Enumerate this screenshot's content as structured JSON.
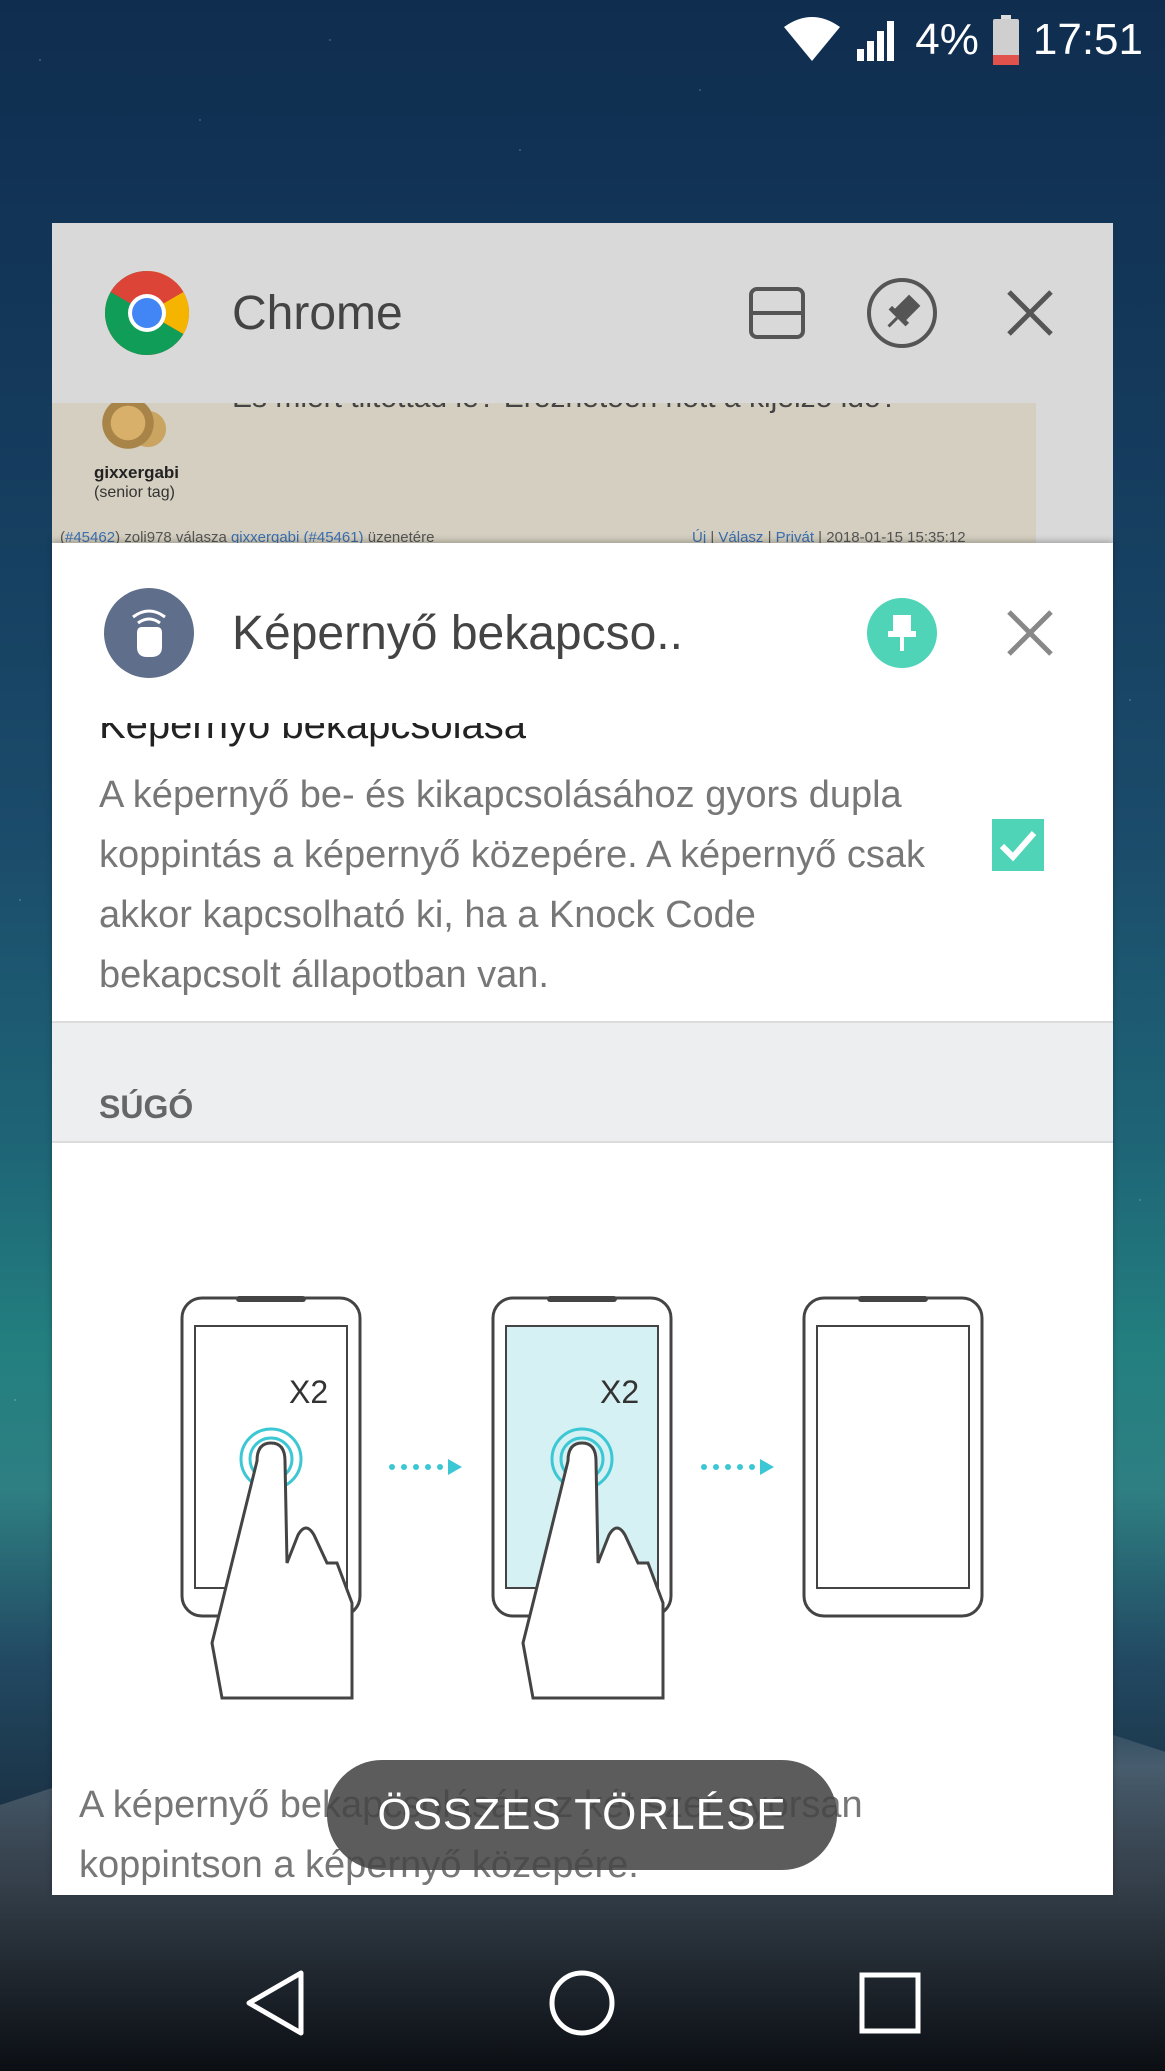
{
  "status_bar": {
    "battery_percent": "4%",
    "time": "17:51",
    "icons": [
      "wifi-icon",
      "signal-icon",
      "battery-icon"
    ]
  },
  "chrome_card": {
    "app_name": "Chrome",
    "icons": [
      "chrome-logo-icon",
      "split-screen-icon",
      "pin-icon",
      "close-icon"
    ],
    "preview": {
      "cropped_line": "Es miert tiltottad le? Erezhetoen hott a kijelzo ido?",
      "username": "gixxergabi",
      "rank": "(senior tag)",
      "meta_left_prefix": "(",
      "meta_left_link1": "#45462",
      "meta_left_mid": ") zoli978 válasza ",
      "meta_left_link2": "gixxergabi",
      "meta_left_link3": " (#45461)",
      "meta_left_suffix": " üzenetére",
      "meta_right_link1": "Új",
      "meta_right_sep1": " | ",
      "meta_right_link2": "Válasz",
      "meta_right_sep2": " | ",
      "meta_right_link3": "Privát",
      "meta_right_date": " | 2018-01-15 15:35:12"
    }
  },
  "settings_card": {
    "app_name": "Képernyő bekapcso..",
    "icons": [
      "knock-hand-icon",
      "pin-icon",
      "close-icon"
    ],
    "setting_title": "Képernyő bekapcsolása",
    "setting_description": "A képernyő be- és kikapcsolásához gyors dupla koppintás a képernyő közepére. A képernyő csak akkor kapcsolható ki, ha a Knock Code bekapcsolt állapotban van.",
    "checkbox_checked": true,
    "help_label": "SÚGÓ",
    "illustration": {
      "step1_label": "X2",
      "step2_label": "X2"
    },
    "help_text": "A képernyő bekapcsolásához két szer gyorsan koppintson a képernyő közepére."
  },
  "clear_all_label": "ÖSSZES TÖRLÉSE",
  "nav_bar": {
    "icons": [
      "back-icon",
      "home-icon",
      "recents-icon"
    ]
  },
  "colors": {
    "accent": "#4fd4b8",
    "knock_icon_bg": "#5f6e8a",
    "chrome_header_bg": "#d9d9d9"
  }
}
